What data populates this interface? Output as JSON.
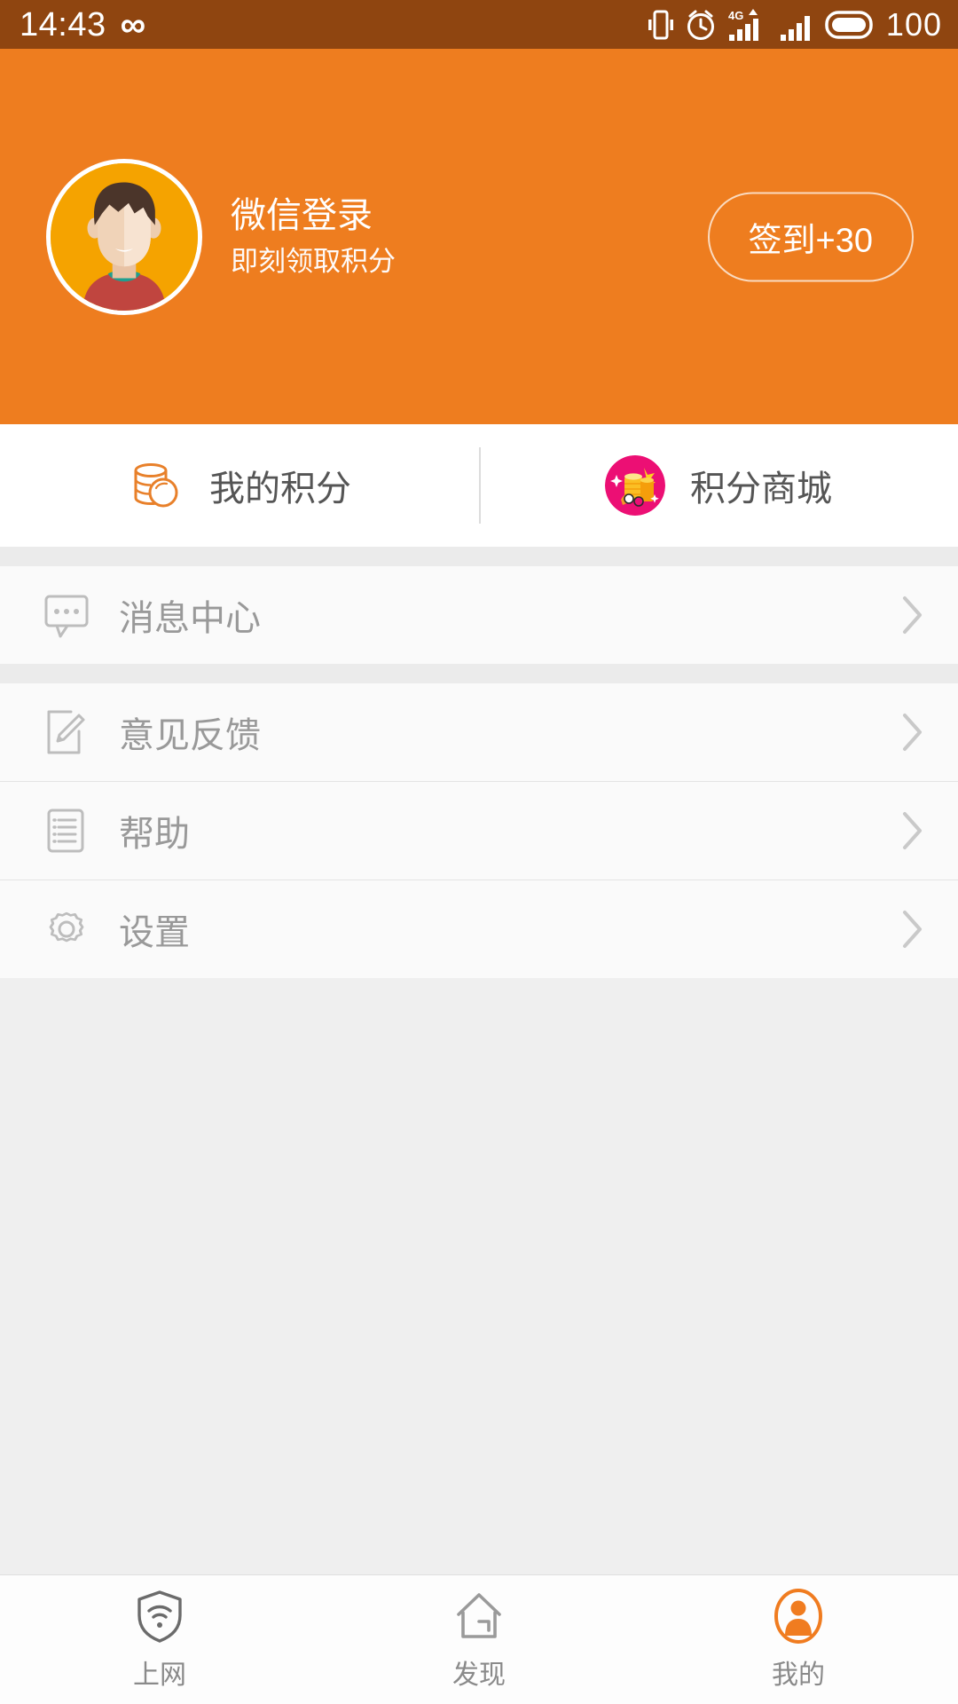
{
  "statusbar": {
    "time": "14:43",
    "infinity_glyph": "∞",
    "battery_percent": "100",
    "icons": [
      "vibrate-icon",
      "alarm-clock-icon",
      "signal-4g-icon",
      "signal-bars-icon",
      "battery-icon"
    ]
  },
  "header": {
    "background_color": "#ee7d1f",
    "avatar_name": "user-avatar",
    "login_title": "微信登录",
    "login_subtitle": "即刻领取积分",
    "checkin_label": "签到+30"
  },
  "points": {
    "left": {
      "label": "我的积分",
      "icon": "coin-stack-icon"
    },
    "right": {
      "label": "积分商城",
      "icon": "points-mall-icon"
    }
  },
  "menu": {
    "group_one": [
      {
        "label": "消息中心",
        "icon": "message-bubble-icon"
      }
    ],
    "group_two": [
      {
        "label": "意见反馈",
        "icon": "edit-pencil-icon"
      },
      {
        "label": "帮助",
        "icon": "document-list-icon"
      },
      {
        "label": "设置",
        "icon": "gear-icon"
      }
    ],
    "chevron": "chevron-right-icon"
  },
  "tabbar": {
    "items": [
      {
        "label": "上网",
        "icon": "wifi-shield-icon",
        "active": false
      },
      {
        "label": "发现",
        "icon": "house-icon",
        "active": false
      },
      {
        "label": "我的",
        "icon": "person-circle-icon",
        "active": true
      }
    ],
    "active_color": "#f07c20",
    "inactive_color": "#8a8a8a"
  }
}
